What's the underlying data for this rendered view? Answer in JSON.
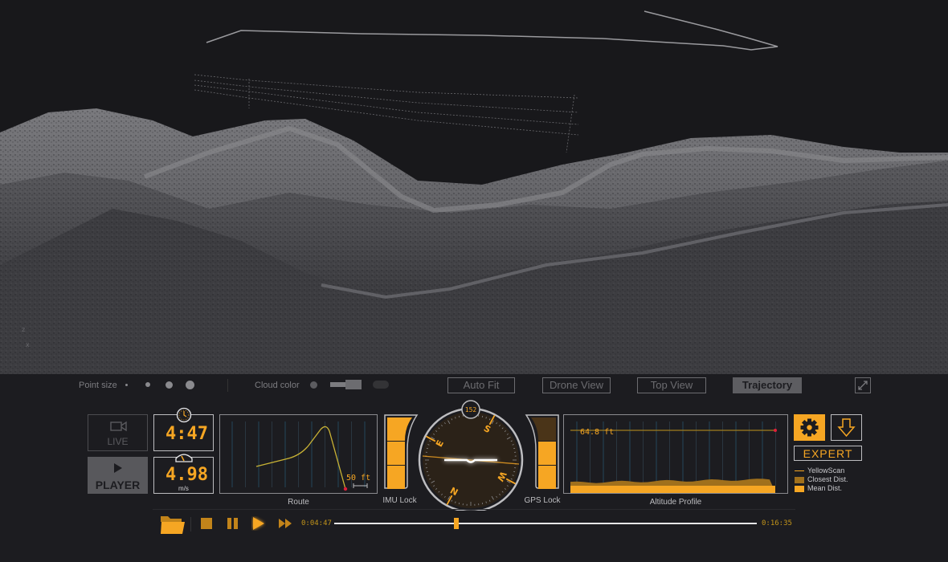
{
  "toolbar": {
    "point_size_label": "Point size",
    "cloud_color_label": "Cloud color",
    "views": [
      {
        "label": "Auto Fit",
        "active": false
      },
      {
        "label": "Drone View",
        "active": false
      },
      {
        "label": "Top View",
        "active": false
      },
      {
        "label": "Trajectory",
        "active": true
      }
    ],
    "fullscreen_icon": "expand-icon"
  },
  "modes": {
    "live_label": "LIVE",
    "live_icon": "camera-icon",
    "player_label": "PLAYER",
    "player_icon": "play-icon",
    "active": "PLAYER"
  },
  "readouts": {
    "time": {
      "value": "4:47",
      "icon": "clock-icon"
    },
    "speed": {
      "value": "4.98",
      "unit": "m/s",
      "icon": "speedometer-icon"
    }
  },
  "route": {
    "label": "Route",
    "scale_label": "50 ft"
  },
  "imu": {
    "label": "IMU Lock",
    "level_segments": 3,
    "filled_segments": 3
  },
  "gps": {
    "label": "GPS Lock",
    "level_segments": 3,
    "filled_segments": 2
  },
  "compass": {
    "heading": "152",
    "cardinals": [
      "N",
      "E",
      "S",
      "W"
    ]
  },
  "altitude": {
    "label": "Altitude Profile",
    "value_label": "64.8 ft"
  },
  "actions": {
    "settings_icon": "gear-icon",
    "download_icon": "download-arrow-icon",
    "expert_label": "EXPERT"
  },
  "legend": [
    {
      "label": "YellowScan",
      "type": "line",
      "color": "#f6a623"
    },
    {
      "label": "Closest Dist.",
      "type": "box",
      "color": "#a0701c"
    },
    {
      "label": "Mean Dist.",
      "type": "box",
      "color": "#f6a623"
    }
  ],
  "playback": {
    "current_time": "0:04:47",
    "total_time": "0:16:35",
    "progress": 0.289,
    "folder_icon": "folder-icon",
    "stop_icon": "stop-icon",
    "pause_icon": "pause-icon",
    "play_icon": "play-icon",
    "fast_forward_icon": "fast-forward-icon"
  },
  "colors": {
    "accent": "#f6a623",
    "accent_dark": "#a0701c",
    "marker": "#e0203a",
    "background": "#1c1c20"
  }
}
